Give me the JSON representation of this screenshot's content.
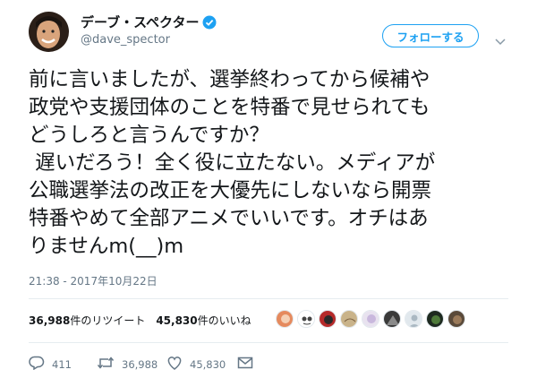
{
  "user": {
    "display_name": "デーブ・スペクター",
    "handle": "@dave_spector",
    "verified": true,
    "follow_label": "フォローする",
    "accent_color": "#1da1f2"
  },
  "tweet": {
    "lines": [
      "前に言いましたが、選挙終わってから候補や",
      "政党や支援団体のことを特番で見せられても",
      "どうしろと言うんですか？",
      " 遅いだろう！全く役に立たない。メディアが",
      "公職選挙法の改正を大優先にしないなら開票",
      "特番やめて全部アニメでいいです。オチはあ",
      "りませんm(__)m"
    ],
    "timestamp": "21:38 - 2017年10月22日"
  },
  "stats": {
    "retweet_count": "36,988",
    "retweet_label": "件のリツイート",
    "like_count": "45,830",
    "like_label": "件のいいね"
  },
  "actions": {
    "reply_count": "411",
    "retweet_count": "36,988",
    "like_count": "45,830",
    "icons": [
      "reply-icon",
      "retweet-icon",
      "like-icon",
      "message-icon"
    ]
  }
}
